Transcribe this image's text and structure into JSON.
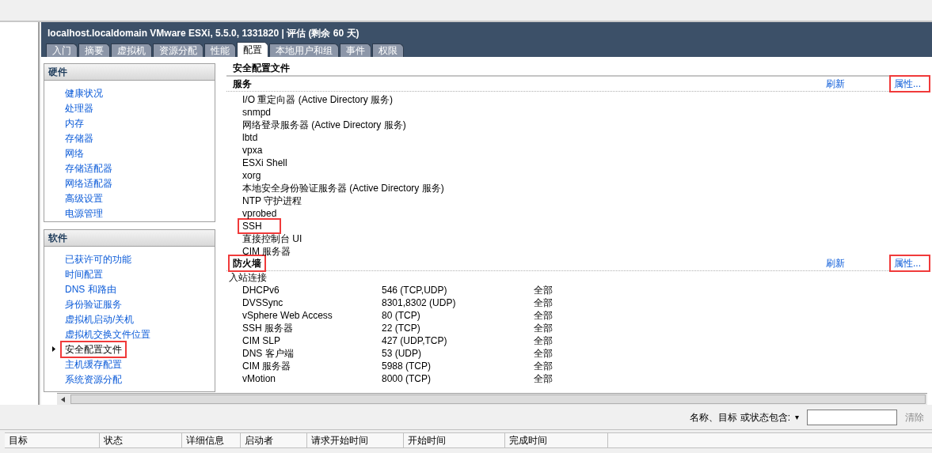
{
  "window": {
    "title": "localhost.localdomain VMware ESXi, 5.5.0, 1331820 | 评估 (剩余 60 天)"
  },
  "tabs": [
    {
      "label": "入门",
      "selected": false
    },
    {
      "label": "摘要",
      "selected": false
    },
    {
      "label": "虚拟机",
      "selected": false
    },
    {
      "label": "资源分配",
      "selected": false
    },
    {
      "label": "性能",
      "selected": false
    },
    {
      "label": "配置",
      "selected": true
    },
    {
      "label": "本地用户和组",
      "selected": false
    },
    {
      "label": "事件",
      "selected": false
    },
    {
      "label": "权限",
      "selected": false
    }
  ],
  "sidebar": {
    "sections": [
      {
        "title": "硬件",
        "items": [
          {
            "label": "健康状况",
            "selected": false,
            "highlighted": false
          },
          {
            "label": "处理器",
            "selected": false,
            "highlighted": false
          },
          {
            "label": "内存",
            "selected": false,
            "highlighted": false
          },
          {
            "label": "存储器",
            "selected": false,
            "highlighted": false
          },
          {
            "label": "网络",
            "selected": false,
            "highlighted": false
          },
          {
            "label": "存储适配器",
            "selected": false,
            "highlighted": false
          },
          {
            "label": "网络适配器",
            "selected": false,
            "highlighted": false
          },
          {
            "label": "高级设置",
            "selected": false,
            "highlighted": false
          },
          {
            "label": "电源管理",
            "selected": false,
            "highlighted": false
          }
        ]
      },
      {
        "title": "软件",
        "items": [
          {
            "label": "已获许可的功能",
            "selected": false,
            "highlighted": false
          },
          {
            "label": "时间配置",
            "selected": false,
            "highlighted": false
          },
          {
            "label": "DNS 和路由",
            "selected": false,
            "highlighted": false
          },
          {
            "label": "身份验证服务",
            "selected": false,
            "highlighted": false
          },
          {
            "label": "虚拟机启动/关机",
            "selected": false,
            "highlighted": false
          },
          {
            "label": "虚拟机交换文件位置",
            "selected": false,
            "highlighted": false
          },
          {
            "label": "安全配置文件",
            "selected": true,
            "highlighted": true
          },
          {
            "label": "主机缓存配置",
            "selected": false,
            "highlighted": false
          },
          {
            "label": "系统资源分配",
            "selected": false,
            "highlighted": false
          }
        ]
      }
    ]
  },
  "content": {
    "title": "安全配置文件",
    "services": {
      "heading": "服务",
      "heading_highlighted": false,
      "refresh": "刷新",
      "properties": "属性...",
      "properties_highlighted": true,
      "items": [
        {
          "label": "I/O 重定向器 (Active Directory 服务)",
          "highlighted": false
        },
        {
          "label": "snmpd",
          "highlighted": false
        },
        {
          "label": "网络登录服务器 (Active Directory 服务)",
          "highlighted": false
        },
        {
          "label": "lbtd",
          "highlighted": false
        },
        {
          "label": "vpxa",
          "highlighted": false
        },
        {
          "label": "ESXi Shell",
          "highlighted": false
        },
        {
          "label": "xorg",
          "highlighted": false
        },
        {
          "label": "本地安全身份验证服务器 (Active Directory 服务)",
          "highlighted": false
        },
        {
          "label": "NTP 守护进程",
          "highlighted": false
        },
        {
          "label": "vprobed",
          "highlighted": false
        },
        {
          "label": "SSH",
          "highlighted": true
        },
        {
          "label": "直接控制台 UI",
          "highlighted": false
        },
        {
          "label": "CIM 服务器",
          "highlighted": false
        }
      ]
    },
    "firewall": {
      "heading": "防火墙",
      "heading_highlighted": true,
      "refresh": "刷新",
      "properties": "属性...",
      "properties_highlighted": true,
      "subheading": "入站连接",
      "rows": [
        [
          "DHCPv6",
          "546 (TCP,UDP)",
          "全部"
        ],
        [
          "DVSSync",
          "8301,8302 (UDP)",
          "全部"
        ],
        [
          "vSphere Web Access",
          "80 (TCP)",
          "全部"
        ],
        [
          "SSH 服务器",
          "22 (TCP)",
          "全部"
        ],
        [
          "CIM SLP",
          "427 (UDP,TCP)",
          "全部"
        ],
        [
          "DNS 客户端",
          "53 (UDP)",
          "全部"
        ],
        [
          "CIM 服务器",
          "5988 (TCP)",
          "全部"
        ],
        [
          "vMotion",
          "8000 (TCP)",
          "全部"
        ]
      ]
    }
  },
  "filter": {
    "label": "名称、目标 或状态包含:",
    "caret": "▾",
    "clear": "清除"
  },
  "tasks": {
    "columns": [
      "目标",
      "状态",
      "详细信息",
      "启动者",
      "请求开始时间",
      "开始时间",
      "完成时间"
    ]
  }
}
